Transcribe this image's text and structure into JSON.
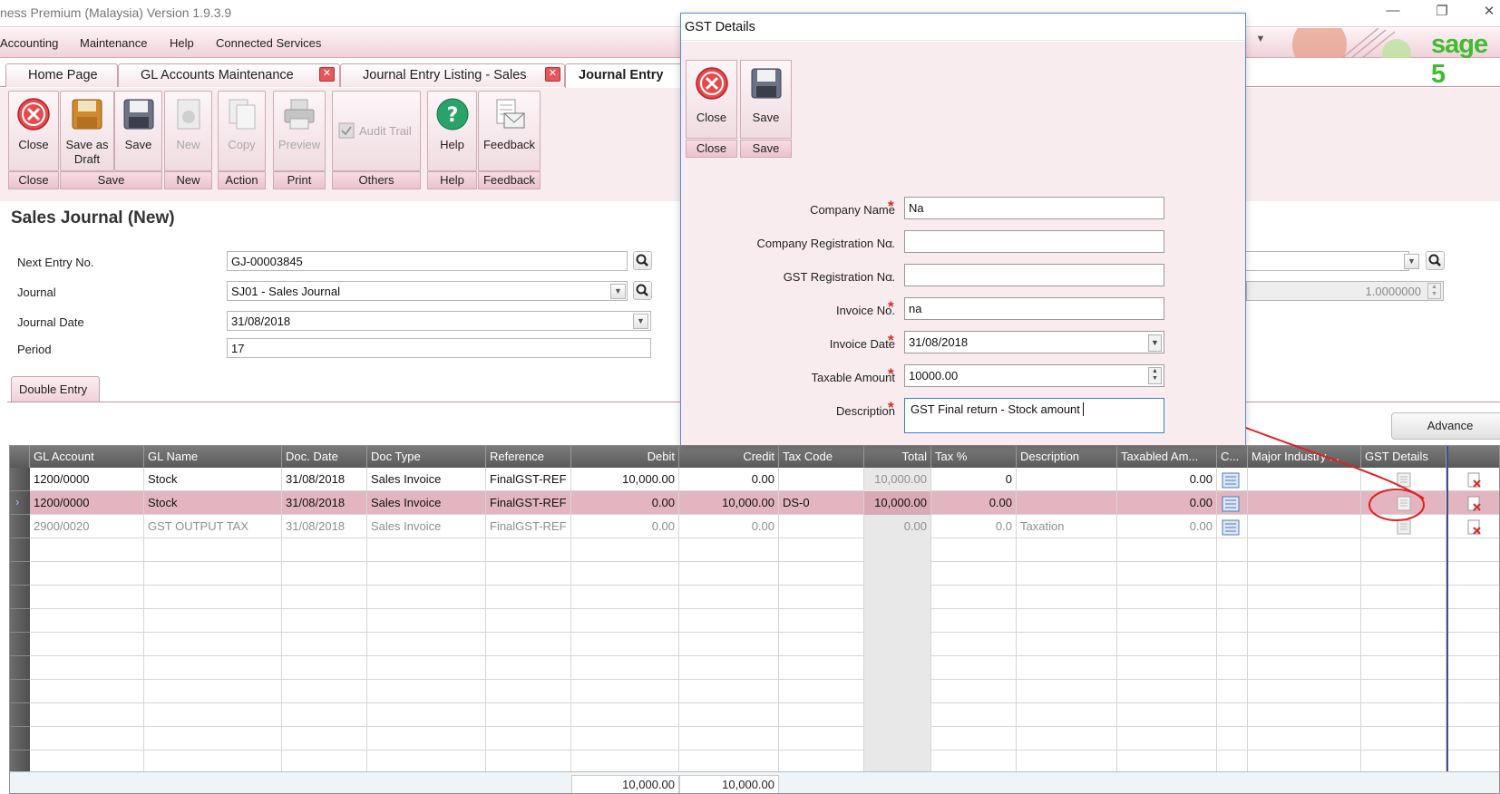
{
  "window": {
    "title": "ness Premium (Malaysia) Version 1.9.3.9",
    "minimize_glyph": "—",
    "restore_glyph": "❐",
    "close_glyph": "✕"
  },
  "menu": {
    "items": [
      "Accounting",
      "Maintenance",
      "Help",
      "Connected Services"
    ],
    "brand": "sage 5"
  },
  "tabs": [
    {
      "label": "Home Page",
      "closable": false
    },
    {
      "label": "GL Accounts Maintenance",
      "closable": true
    },
    {
      "label": "Journal Entry Listing - Sales",
      "closable": true
    },
    {
      "label": "Journal Entry",
      "closable": false,
      "active": true
    }
  ],
  "ribbon": {
    "buttons": [
      {
        "label": "Close",
        "icon": "close-icon",
        "enabled": true
      },
      {
        "label": "Save as Draft",
        "icon": "save-draft-icon",
        "enabled": true
      },
      {
        "label": "Save",
        "icon": "save-icon",
        "enabled": true
      },
      {
        "label": "New",
        "icon": "new-icon",
        "enabled": false
      },
      {
        "label": "Copy",
        "icon": "copy-icon",
        "enabled": false
      },
      {
        "label": "Preview",
        "icon": "print-preview-icon",
        "enabled": false
      },
      {
        "label": "Audit Trail",
        "icon": "audit-trail-icon",
        "enabled": false
      },
      {
        "label": "Help",
        "icon": "help-icon",
        "enabled": true
      },
      {
        "label": "Feedback",
        "icon": "feedback-icon",
        "enabled": true
      }
    ],
    "groups": [
      "Close",
      "Save",
      "New",
      "Action",
      "Print",
      "Others",
      "Help",
      "Feedback"
    ]
  },
  "form": {
    "heading": "Sales Journal (New)",
    "next_entry_label": "Next Entry No.",
    "next_entry_value": "GJ-00003845",
    "journal_label": "Journal",
    "journal_value": "SJ01 - Sales Journal",
    "journal_date_label": "Journal Date",
    "journal_date_value": "31/08/2018",
    "period_label": "Period",
    "period_value": "17",
    "rate_value": "1.0000000"
  },
  "subtab": "Double Entry",
  "advance_button": "Advance",
  "grid": {
    "columns": [
      "GL Account",
      "GL Name",
      "Doc. Date",
      "Doc Type",
      "Reference",
      "Debit",
      "Credit",
      "Tax Code",
      "Total",
      "Tax %",
      "Description",
      "Taxabled Am...",
      "C...",
      "Major Industry ...",
      "GST Details",
      ""
    ],
    "rows": [
      {
        "gl_account": "1200/0000",
        "gl_name": "Stock",
        "doc_date": "31/08/2018",
        "doc_type": "Sales Invoice",
        "reference": "FinalGST-REF",
        "debit": "10,000.00",
        "credit": "0.00",
        "tax_code": "",
        "total": "10,000.00",
        "tax_pct": "0",
        "description": "",
        "taxabled": "0.00",
        "selected": false,
        "muted": false
      },
      {
        "gl_account": "1200/0000",
        "gl_name": "Stock",
        "doc_date": "31/08/2018",
        "doc_type": "Sales Invoice",
        "reference": "FinalGST-REF",
        "debit": "0.00",
        "credit": "10,000.00",
        "tax_code": "DS-0",
        "total": "10,000.00",
        "tax_pct": "0.00",
        "description": "",
        "taxabled": "0.00",
        "selected": true,
        "muted": false
      },
      {
        "gl_account": "2900/0020",
        "gl_name": "GST OUTPUT TAX",
        "doc_date": "31/08/2018",
        "doc_type": "Sales Invoice",
        "reference": "FinalGST-REF",
        "debit": "0.00",
        "credit": "0.00",
        "tax_code": "",
        "total": "0.00",
        "tax_pct": "0.0",
        "description": "Taxation",
        "taxabled": "0.00",
        "selected": false,
        "muted": true
      }
    ],
    "totals": {
      "debit": "10,000.00",
      "credit": "10,000.00"
    }
  },
  "dialog": {
    "title": "GST Details",
    "buttons": [
      {
        "label": "Close",
        "group": "Close",
        "icon": "close-icon"
      },
      {
        "label": "Save",
        "group": "Save",
        "icon": "save-icon"
      }
    ],
    "fields": [
      {
        "label": "Company Name",
        "required": true,
        "value": "Na"
      },
      {
        "label": "Company Registration No.",
        "required": false,
        "value": ""
      },
      {
        "label": "GST Registration No.",
        "required": false,
        "value": ""
      },
      {
        "label": "Invoice No.",
        "required": true,
        "value": "na"
      },
      {
        "label": "Invoice Date",
        "required": true,
        "value": "31/08/2018"
      },
      {
        "label": "Taxable Amount",
        "required": true,
        "value": "10000.00"
      },
      {
        "label": "Description",
        "required": true,
        "value": "GST Final return - Stock amount"
      }
    ]
  },
  "colors": {
    "accent_pink": "#e3b5c1",
    "annotation_red": "#e02020",
    "brand_green": "#3fbc2f"
  }
}
